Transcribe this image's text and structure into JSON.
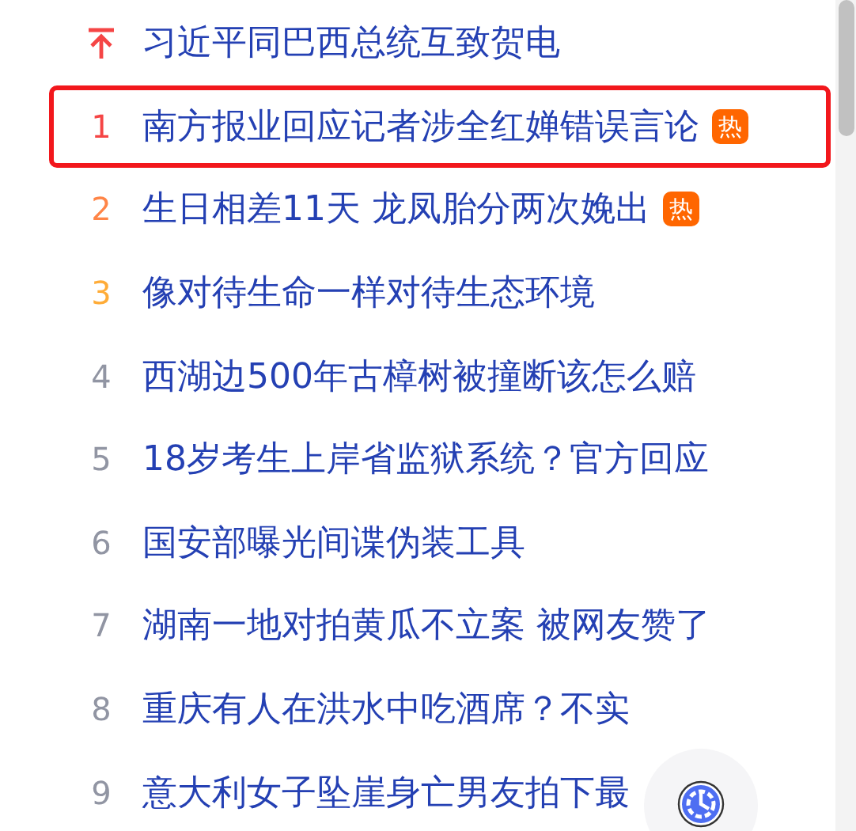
{
  "hot_list": [
    {
      "kind": "pinned",
      "title": "习近平同巴西总统互致贺电",
      "highlighted": false
    },
    {
      "kind": "ranked",
      "rank": "1",
      "color": "#f54545",
      "title": "南方报业回应记者涉全红婵错误言论",
      "badge": "热",
      "highlighted": true
    },
    {
      "kind": "ranked",
      "rank": "2",
      "color": "#ff8547",
      "title": "生日相差11天 龙凤胎分两次娩出",
      "badge": "热",
      "highlighted": false
    },
    {
      "kind": "ranked",
      "rank": "3",
      "color": "#ffac38",
      "title": "像对待生命一样对待生态环境",
      "highlighted": false
    },
    {
      "kind": "ranked",
      "rank": "4",
      "color": "#9195a3",
      "title": "西湖边500年古樟树被撞断该怎么赔",
      "highlighted": false
    },
    {
      "kind": "ranked",
      "rank": "5",
      "color": "#9195a3",
      "title": "18岁考生上岸省监狱系统？官方回应",
      "highlighted": false
    },
    {
      "kind": "ranked",
      "rank": "6",
      "color": "#9195a3",
      "title": "国安部曝光间谍伪装工具",
      "highlighted": false
    },
    {
      "kind": "ranked",
      "rank": "7",
      "color": "#9195a3",
      "title": "湖南一地对拍黄瓜不立案 被网友赞了",
      "highlighted": false
    },
    {
      "kind": "ranked",
      "rank": "8",
      "color": "#9195a3",
      "title": "重庆有人在洪水中吃酒席？不实",
      "highlighted": false
    },
    {
      "kind": "ranked",
      "rank": "9",
      "color": "#9195a3",
      "title": "意大利女子坠崖身亡男友拍下最",
      "highlighted": false
    }
  ]
}
